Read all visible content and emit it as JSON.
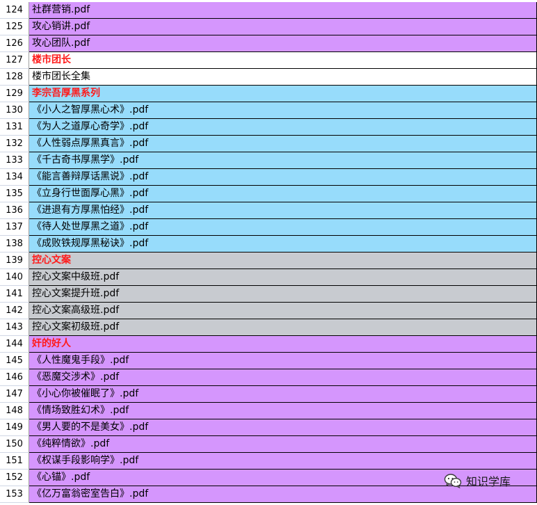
{
  "colors": {
    "purple": "#d596fd",
    "white": "#ffffff",
    "blue": "#97dcfb",
    "gray": "#c8cbd0",
    "header_text": "#ff1a1a"
  },
  "rows": [
    {
      "num": "124",
      "text": "社群营销.pdf",
      "group": "purple",
      "header": false
    },
    {
      "num": "125",
      "text": "攻心销讲.pdf",
      "group": "purple",
      "header": false
    },
    {
      "num": "126",
      "text": "攻心团队.pdf",
      "group": "purple",
      "header": false
    },
    {
      "num": "127",
      "text": "楼市团长",
      "group": "white",
      "header": true
    },
    {
      "num": "128",
      "text": "楼市团长全集",
      "group": "white",
      "header": false
    },
    {
      "num": "129",
      "text": "李宗吾厚黑系列",
      "group": "blue",
      "header": true
    },
    {
      "num": "130",
      "text": "《小人之智厚黑心术》.pdf",
      "group": "blue",
      "header": false
    },
    {
      "num": "131",
      "text": "《为人之道厚心奇学》.pdf",
      "group": "blue",
      "header": false
    },
    {
      "num": "132",
      "text": "《人性弱点厚黑真言》.pdf",
      "group": "blue",
      "header": false
    },
    {
      "num": "133",
      "text": "《千古奇书厚黑学》.pdf",
      "group": "blue",
      "header": false
    },
    {
      "num": "134",
      "text": "《能言善辩厚话黑说》.pdf",
      "group": "blue",
      "header": false
    },
    {
      "num": "135",
      "text": "《立身行世面厚心黑》.pdf",
      "group": "blue",
      "header": false
    },
    {
      "num": "136",
      "text": "《进退有方厚黑怕经》.pdf",
      "group": "blue",
      "header": false
    },
    {
      "num": "137",
      "text": "《待人处世厚黑之道》.pdf",
      "group": "blue",
      "header": false
    },
    {
      "num": "138",
      "text": "《成败铁规厚黑秘诀》.pdf",
      "group": "blue",
      "header": false
    },
    {
      "num": "139",
      "text": "控心文案",
      "group": "gray",
      "header": true
    },
    {
      "num": "140",
      "text": "控心文案中级班.pdf",
      "group": "gray",
      "header": false
    },
    {
      "num": "141",
      "text": "控心文案提升班.pdf",
      "group": "gray",
      "header": false
    },
    {
      "num": "142",
      "text": "控心文案高级班.pdf",
      "group": "gray",
      "header": false
    },
    {
      "num": "143",
      "text": "控心文案初级班.pdf",
      "group": "gray",
      "header": false
    },
    {
      "num": "144",
      "text": "奸的好人",
      "group": "purple",
      "header": true
    },
    {
      "num": "145",
      "text": "《人性魔鬼手段》.pdf",
      "group": "purple",
      "header": false
    },
    {
      "num": "146",
      "text": "《恶魔交涉术》.pdf",
      "group": "purple",
      "header": false
    },
    {
      "num": "147",
      "text": "《小心你被催眠了》.pdf",
      "group": "purple",
      "header": false
    },
    {
      "num": "148",
      "text": "《情场致胜幻术》.pdf",
      "group": "purple",
      "header": false
    },
    {
      "num": "149",
      "text": "《男人要的不是美女》.pdf",
      "group": "purple",
      "header": false
    },
    {
      "num": "150",
      "text": "《纯粹情欲》.pdf",
      "group": "purple",
      "header": false
    },
    {
      "num": "151",
      "text": "《权谋手段影响学》.pdf",
      "group": "purple",
      "header": false
    },
    {
      "num": "152",
      "text": "《心锚》.pdf",
      "group": "purple",
      "header": false
    },
    {
      "num": "153",
      "text": "《亿万富翁密室告白》.pdf",
      "group": "purple",
      "header": false
    }
  ],
  "watermark": {
    "icon": "wechat-icon",
    "text": "知识学库"
  }
}
